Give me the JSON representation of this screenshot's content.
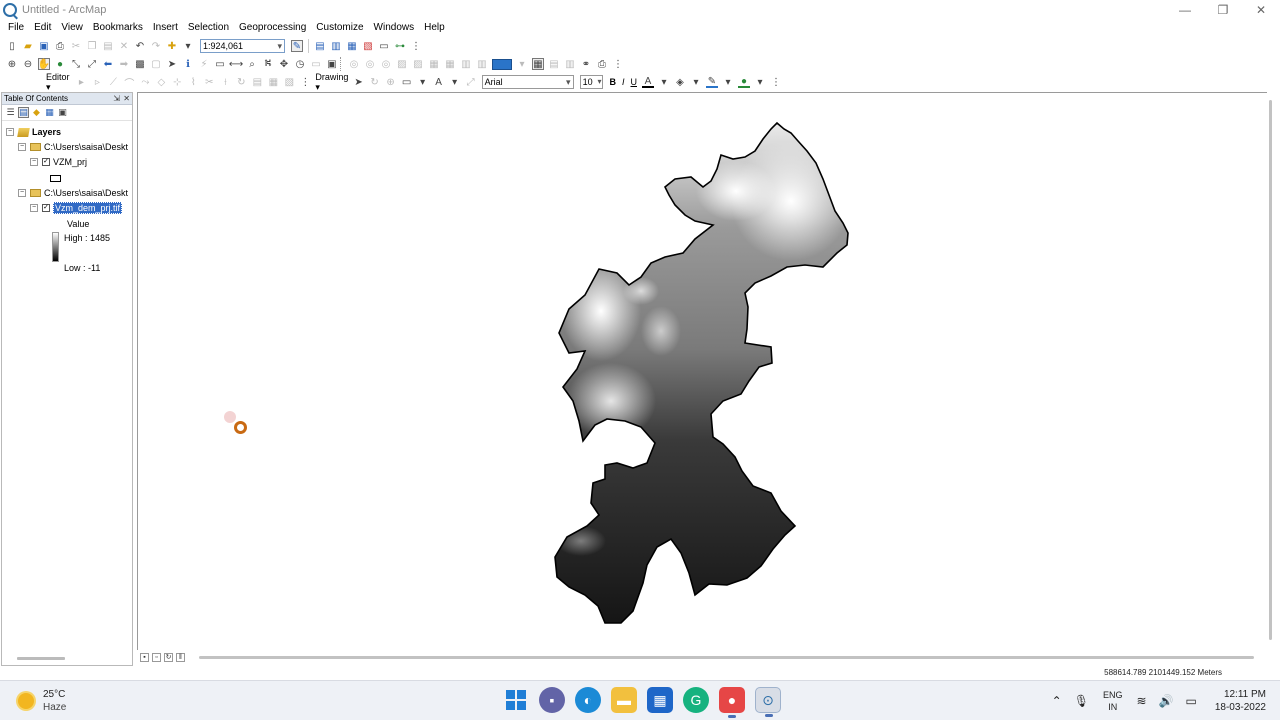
{
  "window": {
    "title": "Untitled - ArcMap",
    "controls": {
      "minimize": "—",
      "maximize": "❐",
      "close": "✕"
    }
  },
  "menu": [
    "File",
    "Edit",
    "View",
    "Bookmarks",
    "Insert",
    "Selection",
    "Geoprocessing",
    "Customize",
    "Windows",
    "Help"
  ],
  "toolbar": {
    "scale": "1:924,061",
    "editor_label": "Editor ▾",
    "drawing_label": "Drawing ▾",
    "font_name": "Arial",
    "font_size": "10",
    "bold": "B",
    "italic": "I",
    "underline": "U",
    "text_tool": "A"
  },
  "toc": {
    "title": "Table Of Contents",
    "pin": "⇲",
    "close": "✕",
    "root_label": "Layers",
    "groups": [
      {
        "path": "C:\\Users\\saisa\\Deskt",
        "layer": "VZM_prj"
      },
      {
        "path": "C:\\Users\\saisa\\Deskt",
        "layer": "Vzm_dem_prj.tif"
      }
    ],
    "legend": {
      "value_label": "Value",
      "high_label": "High : 1485",
      "low_label": "Low : -11"
    },
    "expanded_sign": "−",
    "check_mark": "✓"
  },
  "status": {
    "coordinates": "588614.789  2101449.152 Meters"
  },
  "taskbar": {
    "weather_temp": "25°C",
    "weather_cond": "Haze",
    "lang_line1": "ENG",
    "lang_line2": "IN",
    "time": "12:11 PM",
    "date": "18-03-2022"
  },
  "colors": {
    "accent": "#316ac5",
    "dem_high": "#ffffff",
    "dem_low": "#000000"
  }
}
